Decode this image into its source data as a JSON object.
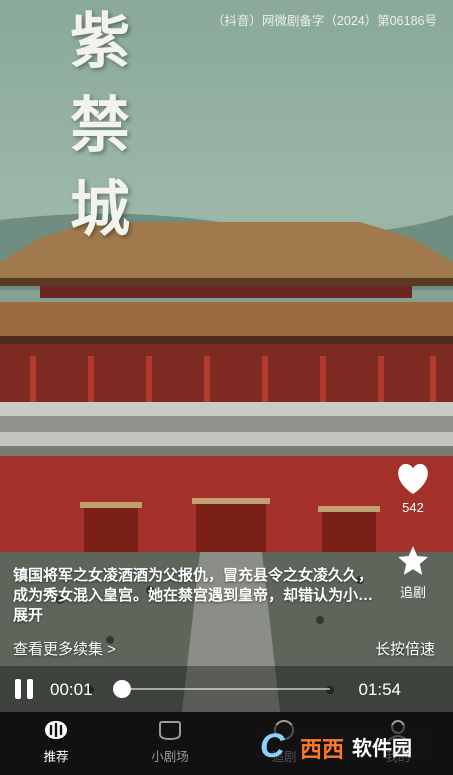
{
  "video": {
    "calligraphy": [
      "紫",
      "禁",
      "城"
    ],
    "license": "（抖音）网微剧备字（2024）第06186号",
    "description": "镇国将军之女凌酒酒为父报仇，冒充县令之女凌久久，成为秀女混入皇宫。她在禁宫遇到皇帝，却错认为小… 展开",
    "more_episodes": "查看更多续集 >",
    "long_press": "长按倍速"
  },
  "actions": {
    "like_count": "542",
    "follow_label": "追剧",
    "like_icon": "heart-icon",
    "follow_icon": "star-icon"
  },
  "player": {
    "current_time": "00:01",
    "total_time": "01:54",
    "progress": 0.01
  },
  "tabs": [
    {
      "label": "推荐",
      "icon": "recommend-icon",
      "active": true
    },
    {
      "label": "小剧场",
      "icon": "theater-icon",
      "active": false
    },
    {
      "label": "追剧",
      "icon": "follow-icon",
      "active": false
    },
    {
      "label": "我的",
      "icon": "profile-icon",
      "active": false
    }
  ],
  "watermark": {
    "logo_letter": "C",
    "text1": "西西",
    "text2": "软件园"
  }
}
